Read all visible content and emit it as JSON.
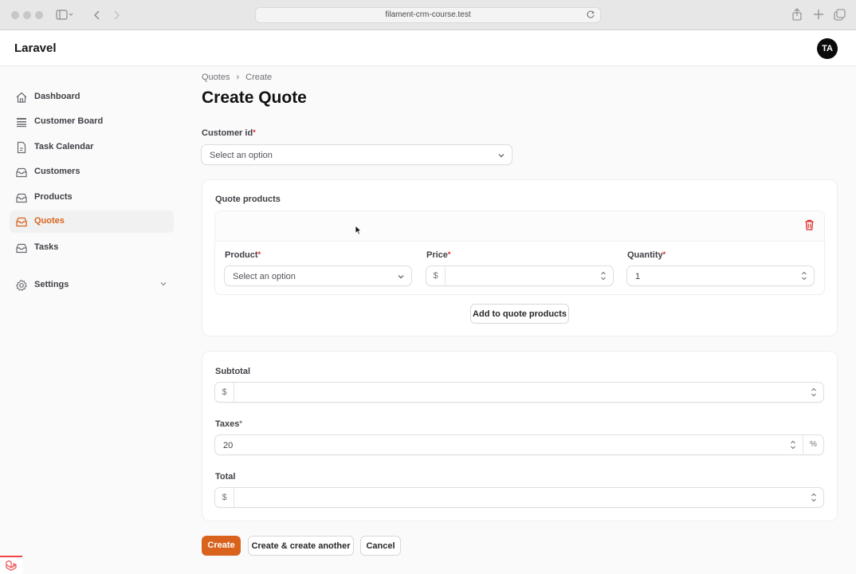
{
  "browser": {
    "url": "filament-crm-course.test"
  },
  "topbar": {
    "brand": "Laravel",
    "avatar_initials": "TA"
  },
  "sidebar": {
    "items": [
      {
        "label": "Dashboard",
        "icon": "home-icon"
      },
      {
        "label": "Customer Board",
        "icon": "list-icon"
      },
      {
        "label": "Task Calendar",
        "icon": "document-icon"
      },
      {
        "label": "Customers",
        "icon": "inbox-icon"
      },
      {
        "label": "Products",
        "icon": "inbox-icon"
      },
      {
        "label": "Quotes",
        "icon": "inbox-icon",
        "active": true
      },
      {
        "label": "Tasks",
        "icon": "inbox-icon"
      }
    ],
    "settings_label": "Settings"
  },
  "breadcrumbs": [
    "Quotes",
    "Create"
  ],
  "page_title": "Create Quote",
  "form": {
    "customer_id": {
      "label": "Customer id",
      "placeholder": "Select an option"
    },
    "quote_products": {
      "section_label": "Quote products",
      "product": {
        "label": "Product",
        "placeholder": "Select an option"
      },
      "price": {
        "label": "Price",
        "prefix": "$",
        "value": ""
      },
      "quantity": {
        "label": "Quantity",
        "value": "1"
      },
      "add_button": "Add to quote products"
    },
    "subtotal": {
      "label": "Subtotal",
      "prefix": "$",
      "value": ""
    },
    "taxes": {
      "label": "Taxes",
      "value": "20",
      "suffix": "%"
    },
    "total": {
      "label": "Total",
      "prefix": "$",
      "value": ""
    },
    "required_marker": "*"
  },
  "actions": {
    "create": "Create",
    "create_another": "Create & create another",
    "cancel": "Cancel"
  },
  "colors": {
    "accent": "#d9631c",
    "danger": "#dc2626"
  }
}
